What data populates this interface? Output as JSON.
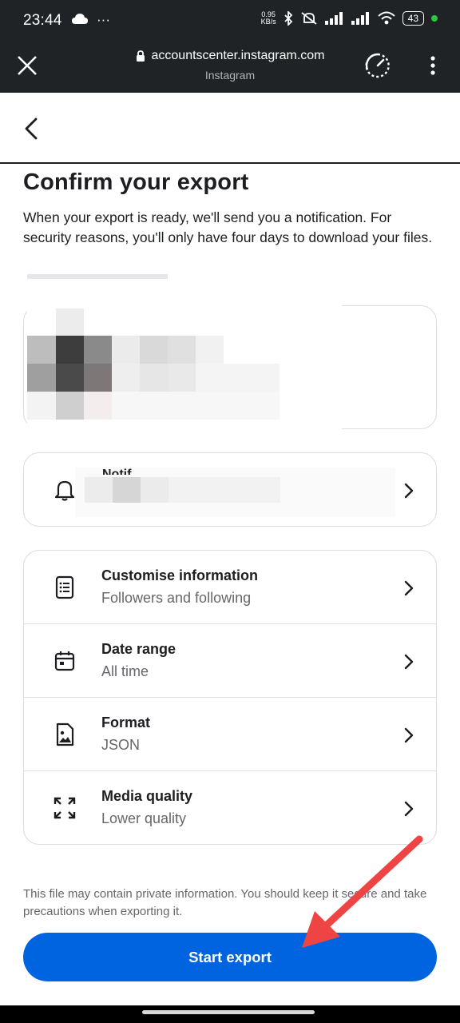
{
  "status_bar": {
    "time": "23:44",
    "left_icons": [
      "cloud-icon",
      "more-icon"
    ],
    "net_speed_value": "0.95",
    "net_speed_unit": "KB/s",
    "battery": "43",
    "colors": {
      "background": "#1f2326",
      "dot": "#27c93f"
    }
  },
  "browser": {
    "url": "accountscenter.instagram.com",
    "site_name": "Instagram"
  },
  "page": {
    "title": "Confirm your export",
    "description": "When your export is ready, we'll send you a notification. For security reasons, you'll only have four days to download your files."
  },
  "notification_row": {
    "label_visible": "Notif..."
  },
  "settings": [
    {
      "title": "Customise information",
      "value": "Followers and following",
      "icon": "document-list-icon"
    },
    {
      "title": "Date range",
      "value": "All time",
      "icon": "calendar-icon"
    },
    {
      "title": "Format",
      "value": "JSON",
      "icon": "image-file-icon"
    },
    {
      "title": "Media quality",
      "value": "Lower quality",
      "icon": "expand-arrows-icon"
    }
  ],
  "footnote": "This file may contain private information. You should keep it secure and take precautions when exporting it.",
  "start_button": "Start export",
  "colors": {
    "primary": "#0064e0",
    "annotation_arrow": "#ef4444",
    "border": "#dadde1",
    "secondary_text": "#65676b"
  }
}
